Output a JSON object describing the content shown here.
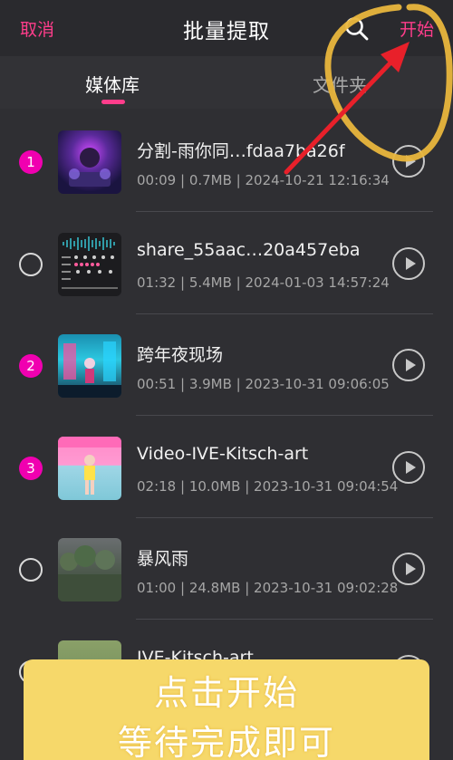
{
  "header": {
    "cancel_label": "取消",
    "title": "批量提取",
    "search_icon": "search-icon",
    "start_label": "开始"
  },
  "tabs": [
    {
      "label": "媒体库",
      "active": true
    },
    {
      "label": "文件夹",
      "active": false
    }
  ],
  "colors": {
    "accent": "#ff3d8b",
    "selected_badge": "#f000b0",
    "banner": "#f6d86a",
    "annotation_arrow": "#e8202a",
    "annotation_circle": "#e9b63d"
  },
  "items": [
    {
      "order": "1",
      "selected": true,
      "name": "分割-雨你同…fdaa7ba26f",
      "meta": "00:09 | 0.7MB | 2024-10-21 12:16:34"
    },
    {
      "order": "",
      "selected": false,
      "name": "share_55aac…20a457eba",
      "meta": "01:32 | 5.4MB | 2024-01-03 14:57:24"
    },
    {
      "order": "2",
      "selected": true,
      "name": "跨年夜现场",
      "meta": "00:51 | 3.9MB | 2023-10-31 09:06:05"
    },
    {
      "order": "3",
      "selected": true,
      "name": "Video-IVE-Kitsch-art",
      "meta": "02:18 | 10.0MB | 2023-10-31 09:04:54"
    },
    {
      "order": "",
      "selected": false,
      "name": "暴风雨",
      "meta": "01:00 | 24.8MB | 2023-10-31 09:02:28"
    },
    {
      "order": "",
      "selected": false,
      "name": "IVE-Kitsch-art",
      "meta": ""
    }
  ],
  "banner": {
    "line1": "点击开始",
    "line2": "等待完成即可"
  }
}
